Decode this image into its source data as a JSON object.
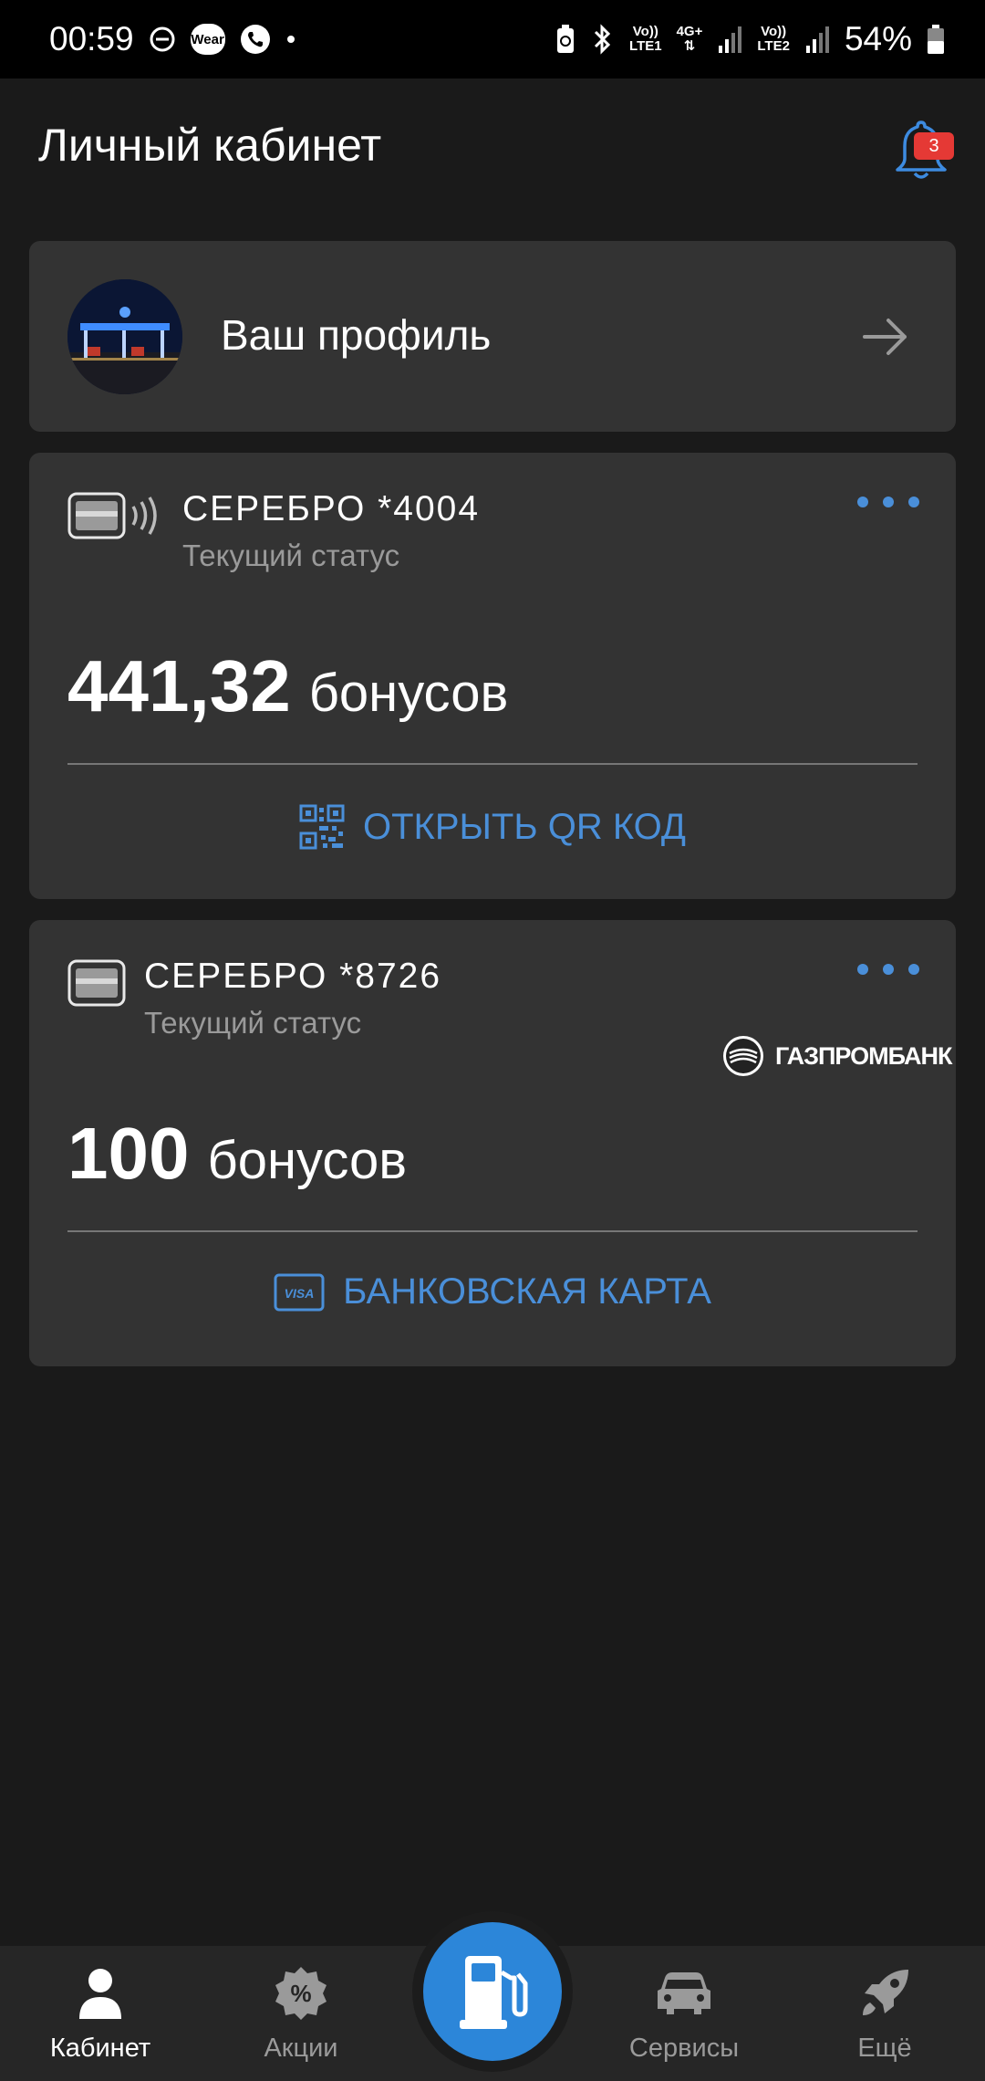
{
  "status_bar": {
    "time": "00:59",
    "wear_label": "Wear",
    "net1_top": "Vo))",
    "net1_bottom": "LTE1",
    "net_mid": "4G+",
    "net2_top": "Vo))",
    "net2_bottom": "LTE2",
    "battery": "54%"
  },
  "header": {
    "title": "Личный кабинет",
    "notification_count": "3"
  },
  "profile": {
    "label": "Ваш профиль"
  },
  "cards": [
    {
      "title": "СЕРЕБРО *4004",
      "status": "Текущий статус",
      "balance_value": "441,32",
      "balance_unit": "бонусов",
      "action_label": "ОТКРЫТЬ QR КОД",
      "action_icon": "qr-code-icon"
    },
    {
      "title": "СЕРЕБРО *8726",
      "status": "Текущий статус",
      "bank": "ГАЗПРОМБАНК",
      "balance_value": "100",
      "balance_unit": "бонусов",
      "action_label": "БАНКОВСКАЯ КАРТА",
      "action_icon": "visa-card-icon",
      "visa": "VISA"
    }
  ],
  "bottom_nav": {
    "items": [
      {
        "label": "Кабинет",
        "icon": "user-icon",
        "active": true
      },
      {
        "label": "Акции",
        "icon": "percent-badge-icon",
        "active": false
      },
      {
        "label": "",
        "icon": "fuel-pump-icon",
        "active": false
      },
      {
        "label": "Сервисы",
        "icon": "car-icon",
        "active": false
      },
      {
        "label": "Ещё",
        "icon": "rocket-icon",
        "active": false
      }
    ]
  },
  "colors": {
    "background": "#1a1a1a",
    "card": "#333333",
    "accent": "#4a8fd9",
    "badge": "#e53935",
    "fuel_button": "#2c86d9"
  }
}
